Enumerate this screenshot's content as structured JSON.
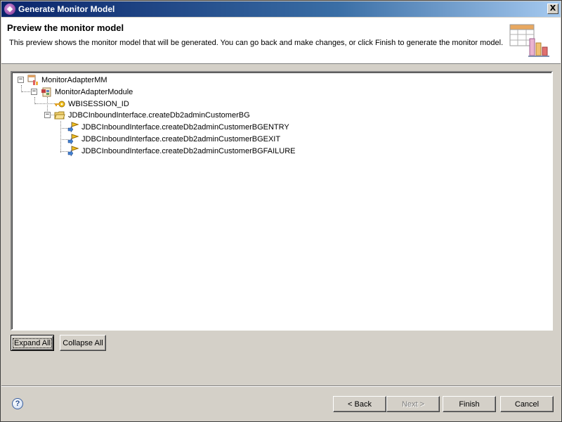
{
  "window": {
    "title": "Generate Monitor Model",
    "close_glyph": "X"
  },
  "header": {
    "title": "Preview the monitor model",
    "description": "This preview shows the monitor model that will be generated. You can go back and make changes, or click Finish to generate the monitor model.",
    "icon": "monitor-model-wizard-icon"
  },
  "tree": {
    "nodes": [
      {
        "label": "MonitorAdapterMM",
        "icon": "monitor-model-icon",
        "level": 0,
        "expanded": true
      },
      {
        "label": "MonitorAdapterModule",
        "icon": "module-icon",
        "level": 1,
        "expanded": true
      },
      {
        "label": "WBISESSION_ID",
        "icon": "key-icon",
        "level": 2
      },
      {
        "label": "JDBCInboundInterface.createDb2adminCustomerBG",
        "icon": "folder-icon",
        "level": 2,
        "expanded": true
      },
      {
        "label": "JDBCInboundInterface.createDb2adminCustomerBGENTRY",
        "icon": "event-icon",
        "level": 3
      },
      {
        "label": "JDBCInboundInterface.createDb2adminCustomerBGEXIT",
        "icon": "event-icon",
        "level": 3
      },
      {
        "label": "JDBCInboundInterface.createDb2adminCustomerBGFAILURE",
        "icon": "event-icon",
        "level": 3
      }
    ],
    "expand_glyph": "−"
  },
  "buttons": {
    "expand_all": "Expand All",
    "collapse_all": "Collapse All",
    "back": "< Back",
    "next": "Next >",
    "finish": "Finish",
    "cancel": "Cancel"
  },
  "help": {
    "glyph": "?"
  },
  "colors": {
    "titlebar_start": "#0a246a",
    "titlebar_end": "#a6caf0",
    "dialog_bg": "#d4d0c8"
  }
}
